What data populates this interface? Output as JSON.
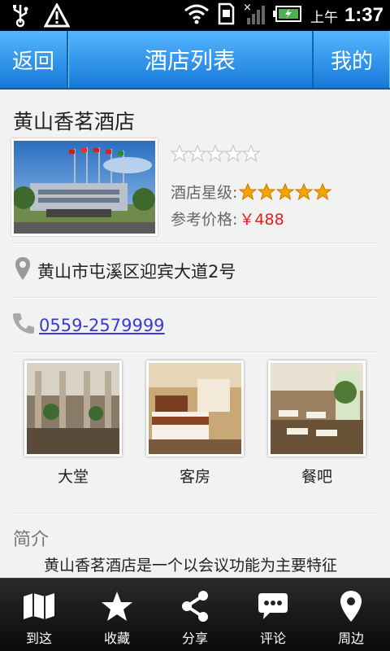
{
  "status_bar": {
    "ampm": "上午",
    "time": "1:37",
    "icons": [
      "usb-icon",
      "warning-icon",
      "wifi-icon",
      "sd-card-icon",
      "signal-icon",
      "battery-icon"
    ]
  },
  "header": {
    "back_label": "返回",
    "title": "酒店列表",
    "mine_label": "我的"
  },
  "hotel": {
    "name": "黄山香茗酒店",
    "user_rating_outline_stars": 5,
    "star_level_label": "酒店星级:",
    "star_level": 5,
    "price_label": "参考价格:",
    "price": "￥488",
    "address": "黄山市屯溪区迎宾大道2号",
    "phone": "0559-2579999"
  },
  "gallery": [
    {
      "label": "大堂"
    },
    {
      "label": "客房"
    },
    {
      "label": "餐吧"
    }
  ],
  "intro": {
    "title": "简介",
    "text": "黄山香茗酒店是一个以会议功能为主要特征"
  },
  "tabbar": [
    {
      "label": "到这",
      "icon": "map-icon"
    },
    {
      "label": "收藏",
      "icon": "star-icon"
    },
    {
      "label": "分享",
      "icon": "share-icon"
    },
    {
      "label": "评论",
      "icon": "comment-icon"
    },
    {
      "label": "周边",
      "icon": "location-pin-icon"
    }
  ],
  "colors": {
    "header_gradient_top": "#55b6ff",
    "header_gradient_bottom": "#1679d8",
    "price": "#e02020",
    "link": "#3a3ad0",
    "star_gold": "#f5a300"
  }
}
